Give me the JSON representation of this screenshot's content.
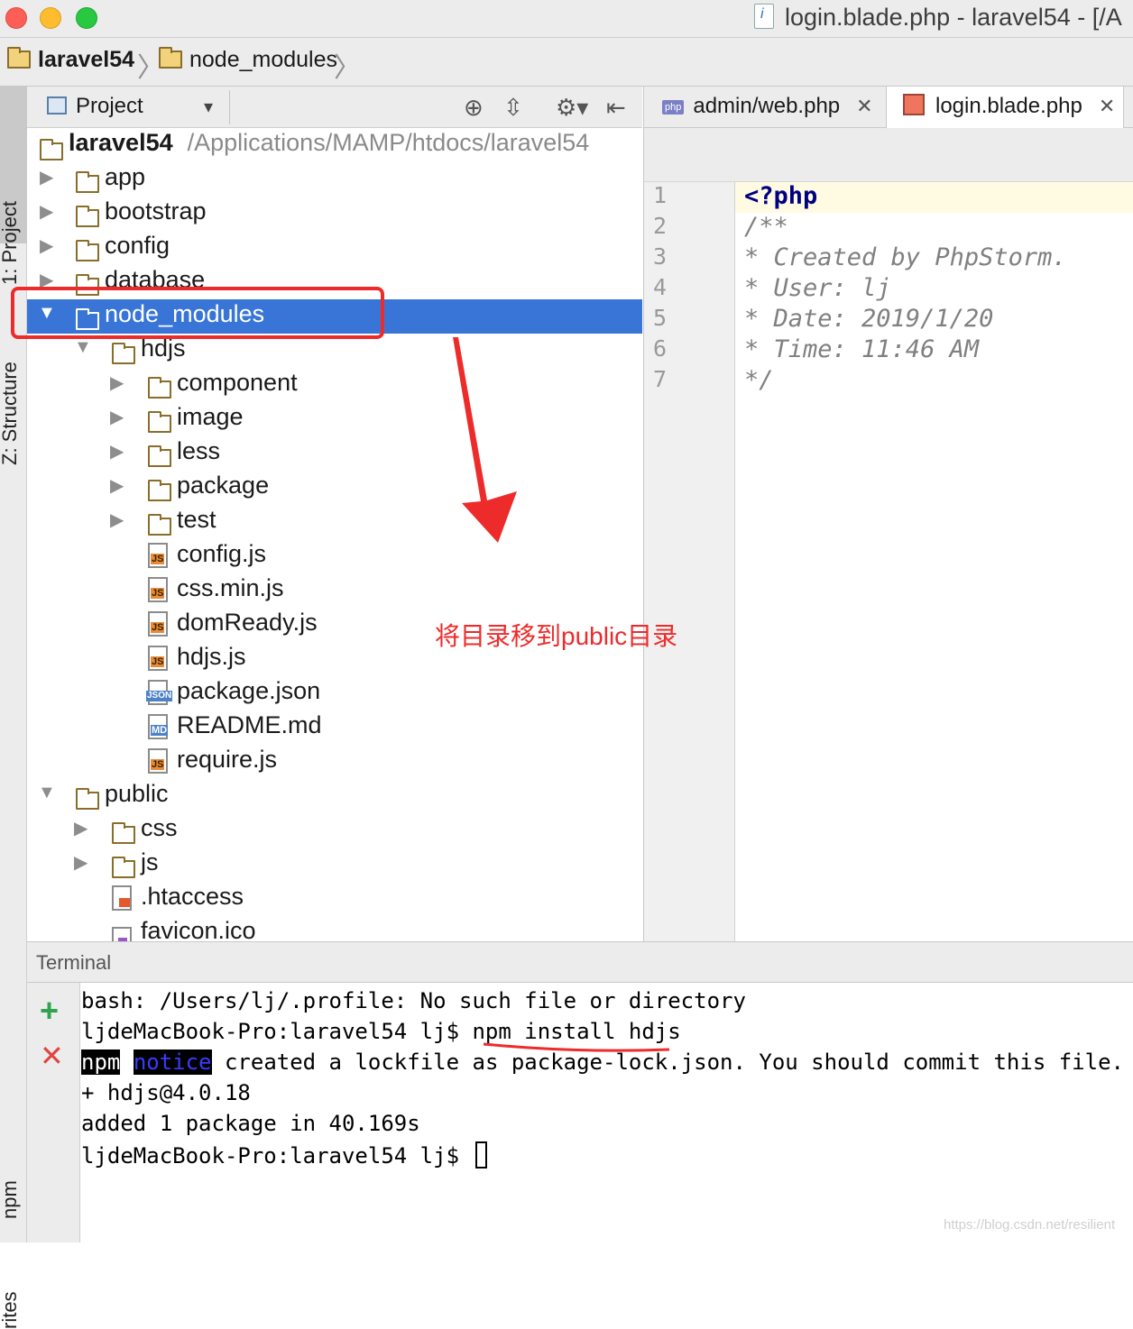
{
  "window": {
    "title": "login.blade.php - laravel54 - [/A"
  },
  "breadcrumb": {
    "items": [
      "laravel54",
      "node_modules"
    ]
  },
  "side_tabs": {
    "project": "1: Project",
    "structure": "Z: Structure",
    "npm": "npm",
    "favorites": "rites"
  },
  "project_panel": {
    "title": "Project",
    "root": {
      "name": "laravel54",
      "path": "/Applications/MAMP/htdocs/laravel54"
    },
    "items": [
      {
        "label": "app"
      },
      {
        "label": "bootstrap"
      },
      {
        "label": "config"
      },
      {
        "label": "database"
      },
      {
        "label": "node_modules"
      },
      {
        "label": "hdjs"
      },
      {
        "label": "component"
      },
      {
        "label": "image"
      },
      {
        "label": "less"
      },
      {
        "label": "package"
      },
      {
        "label": "test"
      },
      {
        "label": "config.js"
      },
      {
        "label": "css.min.js"
      },
      {
        "label": "domReady.js"
      },
      {
        "label": "hdjs.js"
      },
      {
        "label": "package.json"
      },
      {
        "label": "README.md"
      },
      {
        "label": "require.js"
      },
      {
        "label": "public"
      },
      {
        "label": "css"
      },
      {
        "label": "js"
      },
      {
        "label": ".htaccess"
      },
      {
        "label": "favicon.ico"
      }
    ]
  },
  "editor": {
    "tabs": [
      {
        "label": "admin/web.php"
      },
      {
        "label": "login.blade.php"
      }
    ],
    "line_numbers": [
      "1",
      "2",
      "3",
      "4",
      "5",
      "6",
      "7"
    ],
    "lines": [
      "<?php",
      "/**",
      " * Created by PhpStorm.",
      " * User: lj",
      " * Date: 2019/1/20",
      " * Time: 11:46 AM",
      " */"
    ]
  },
  "terminal": {
    "title": "Terminal",
    "lines": {
      "l1": "bash: /Users/lj/.profile: No such file or directory",
      "l2": "ljdeMacBook-Pro:laravel54 lj$ npm install hdjs",
      "l3_npm": "npm",
      "l3_notice": "notice",
      "l3_rest": " created a lockfile as package-lock.json. You should commit this file.",
      "l4": "+ hdjs@4.0.18",
      "l5": "added 1 package in 40.169s",
      "l6": "ljdeMacBook-Pro:laravel54 lj$ "
    }
  },
  "annotation": {
    "text": "将目录移到public目录",
    "color": "#ee2b2b"
  },
  "watermark": "https://blog.csdn.net/resilient"
}
